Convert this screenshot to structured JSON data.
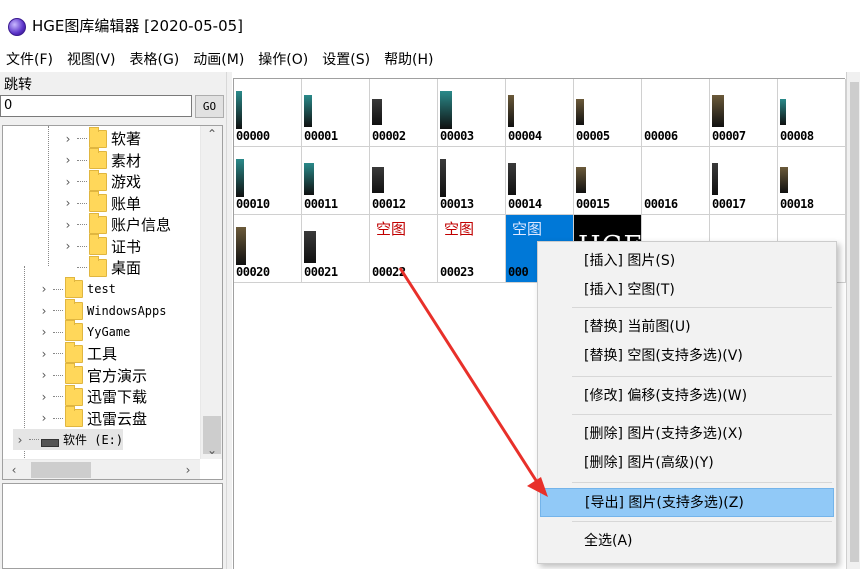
{
  "window": {
    "title": "HGE图库编辑器 [2020-05-05]"
  },
  "menu": [
    "文件(F)",
    "视图(V)",
    "表格(G)",
    "动画(M)",
    "操作(O)",
    "设置(S)",
    "帮助(H)"
  ],
  "jump": {
    "label": "跳转",
    "value": "0",
    "go_label": "GO"
  },
  "tree": {
    "items": [
      {
        "label": "软著",
        "mono": false
      },
      {
        "label": "素材",
        "mono": false
      },
      {
        "label": "游戏",
        "mono": false
      },
      {
        "label": "账单",
        "mono": false
      },
      {
        "label": "账户信息",
        "mono": false
      },
      {
        "label": "证书",
        "mono": false
      },
      {
        "label": "桌面",
        "mono": false
      },
      {
        "label": "test",
        "mono": true
      },
      {
        "label": "WindowsApps",
        "mono": true
      },
      {
        "label": "YyGame",
        "mono": true
      },
      {
        "label": "工具",
        "mono": false
      },
      {
        "label": "官方演示",
        "mono": false
      },
      {
        "label": "迅雷下载",
        "mono": false
      },
      {
        "label": "迅雷云盘",
        "mono": false
      },
      {
        "label": "软件 (E:)",
        "mono": true
      }
    ]
  },
  "grid": {
    "cells": [
      {
        "num": "00000",
        "kind": "img",
        "tone": "teal"
      },
      {
        "num": "00001",
        "kind": "img",
        "tone": "teal"
      },
      {
        "num": "00002",
        "kind": "img",
        "tone": "dark"
      },
      {
        "num": "00003",
        "kind": "img",
        "tone": "teal"
      },
      {
        "num": "00004",
        "kind": "img",
        "tone": "brown"
      },
      {
        "num": "00005",
        "kind": "img",
        "tone": "brown"
      },
      {
        "num": "00006",
        "kind": "img",
        "tone": "none"
      },
      {
        "num": "00007",
        "kind": "img",
        "tone": "brown"
      },
      {
        "num": "00008",
        "kind": "img",
        "tone": "teal"
      },
      {
        "num": "00010",
        "kind": "img",
        "tone": "teal"
      },
      {
        "num": "00011",
        "kind": "img",
        "tone": "teal"
      },
      {
        "num": "00012",
        "kind": "img",
        "tone": "dark"
      },
      {
        "num": "00013",
        "kind": "img",
        "tone": "dark"
      },
      {
        "num": "00014",
        "kind": "img",
        "tone": "dark"
      },
      {
        "num": "00015",
        "kind": "img",
        "tone": "brown"
      },
      {
        "num": "00016",
        "kind": "img",
        "tone": "none"
      },
      {
        "num": "00017",
        "kind": "img",
        "tone": "dark"
      },
      {
        "num": "00018",
        "kind": "img",
        "tone": "brown"
      },
      {
        "num": "00020",
        "kind": "img",
        "tone": "brown"
      },
      {
        "num": "00021",
        "kind": "img",
        "tone": "dark"
      },
      {
        "num": "00022",
        "kind": "empty",
        "label": "空图"
      },
      {
        "num": "00023",
        "kind": "empty",
        "label": "空图"
      },
      {
        "num": "000",
        "kind": "selected",
        "label": "空图"
      },
      {
        "num": "",
        "kind": "hge",
        "label": "HGE"
      }
    ]
  },
  "context_menu": {
    "items": [
      "[插入] 图片(S)",
      "[插入] 空图(T)",
      "[替换] 当前图(U)",
      "[替换] 空图(支持多选)(V)",
      "[修改] 偏移(支持多选)(W)",
      "[删除] 图片(支持多选)(X)",
      "[删除] 图片(高级)(Y)",
      "[导出] 图片(支持多选)(Z)",
      "全选(A)"
    ],
    "highlighted_index": 7
  },
  "colors": {
    "accent": "#0078d7",
    "highlight": "#91c9f7",
    "annotation": "#e8302a",
    "empty_label": "#c00000"
  }
}
